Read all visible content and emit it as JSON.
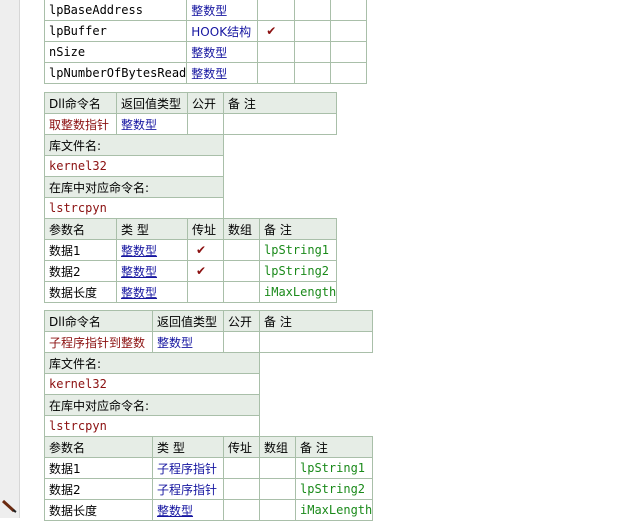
{
  "top_params": {
    "rows": [
      {
        "name": "lpBaseAddress",
        "type": "整数型",
        "byref": "",
        "array": "",
        "note": ""
      },
      {
        "name": "lpBuffer",
        "type": "HOOK结构",
        "byref": "✔",
        "array": "",
        "note": ""
      },
      {
        "name": "nSize",
        "type": "整数型",
        "byref": "",
        "array": "",
        "note": ""
      },
      {
        "name": "lpNumberOfBytesRead",
        "type": "整数型",
        "byref": "",
        "array": "",
        "note": ""
      }
    ]
  },
  "dll_commands": [
    {
      "header": {
        "name": "Dll命令名",
        "return_type": "返回值类型",
        "public": "公开",
        "note": "备 注"
      },
      "name": "取整数指针",
      "return_type": "整数型",
      "public": "",
      "note": "",
      "lib_label": "库文件名:",
      "lib": "kernel32",
      "entry_label": "在库中对应命令名:",
      "entry": "lstrcpyn",
      "param_header": {
        "name": "参数名",
        "type": "类 型",
        "byref": "传址",
        "array": "数组",
        "note": "备 注"
      },
      "params": [
        {
          "name": "数据1",
          "type": "整数型",
          "byref": "✔",
          "array": "",
          "note": "lpString1"
        },
        {
          "name": "数据2",
          "type": "整数型",
          "byref": "✔",
          "array": "",
          "note": "lpString2"
        },
        {
          "name": "数据长度",
          "type": "整数型",
          "byref": "",
          "array": "",
          "note": "iMaxLength"
        }
      ]
    },
    {
      "header": {
        "name": "Dll命令名",
        "return_type": "返回值类型",
        "public": "公开",
        "note": "备 注"
      },
      "name": "子程序指针到整数",
      "return_type": "整数型",
      "public": "",
      "note": "",
      "lib_label": "库文件名:",
      "lib": "kernel32",
      "entry_label": "在库中对应命令名:",
      "entry": "lstrcpyn",
      "param_header": {
        "name": "参数名",
        "type": "类 型",
        "byref": "传址",
        "array": "数组",
        "note": "备 注"
      },
      "params": [
        {
          "name": "数据1",
          "type": "子程序指针",
          "byref": "",
          "array": "",
          "note": "lpString1"
        },
        {
          "name": "数据2",
          "type": "子程序指针",
          "byref": "",
          "array": "",
          "note": "lpString2"
        },
        {
          "name": "数据长度",
          "type": "整数型",
          "byref": "",
          "array": "",
          "note": "iMaxLength"
        }
      ]
    }
  ],
  "icons": {
    "gutter_marker": "pencil-icon"
  }
}
